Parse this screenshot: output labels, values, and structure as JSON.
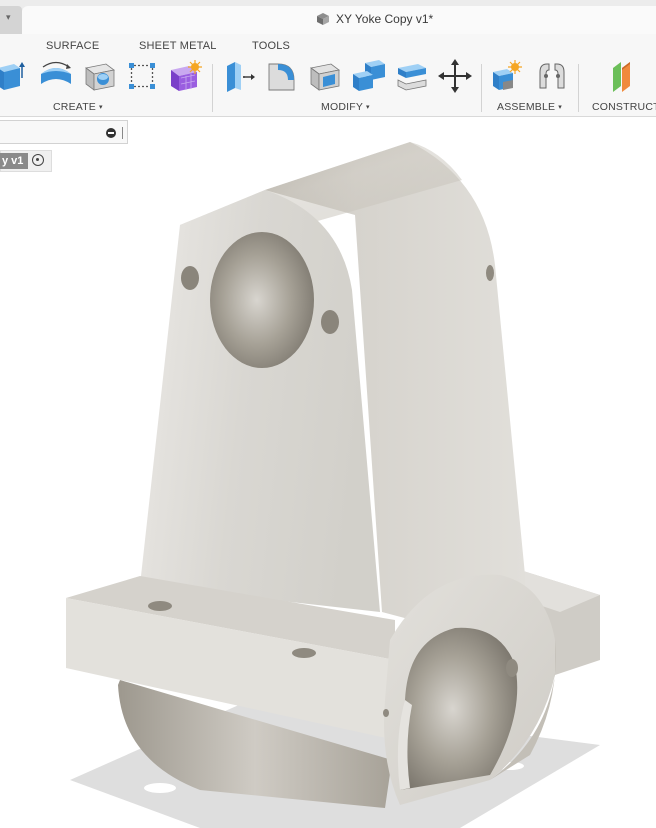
{
  "window": {
    "title": "XY Yoke Copy v1*",
    "tab_arrow": "▾"
  },
  "ribbon": {
    "tabs": [
      {
        "label": "SURFACE"
      },
      {
        "label": "SHEET METAL"
      },
      {
        "label": "TOOLS"
      }
    ],
    "groups": [
      {
        "label": "CREATE",
        "caret": "▾"
      },
      {
        "label": "MODIFY",
        "caret": "▾"
      },
      {
        "label": "ASSEMBLE",
        "caret": "▾"
      },
      {
        "label": "CONSTRUCT"
      }
    ],
    "tools": [
      {
        "icon": "extrude-icon"
      },
      {
        "icon": "revolve-icon"
      },
      {
        "icon": "hole-icon"
      },
      {
        "icon": "pattern-icon"
      },
      {
        "icon": "create-form-icon"
      },
      {
        "icon": "press-pull-icon"
      },
      {
        "icon": "fillet-icon"
      },
      {
        "icon": "shell-icon"
      },
      {
        "icon": "combine-icon"
      },
      {
        "icon": "offset-face-icon"
      },
      {
        "icon": "move-icon"
      },
      {
        "icon": "new-component-icon"
      },
      {
        "icon": "joint-icon"
      },
      {
        "icon": "offset-plane-icon"
      }
    ]
  },
  "browser": {
    "component_tag": "y v1"
  },
  "colors": {
    "accent_blue": "#3a8fd6",
    "light_blue": "#9fd0f5",
    "part_face": "#dedcd7",
    "part_shadow": "#a9a49a"
  }
}
